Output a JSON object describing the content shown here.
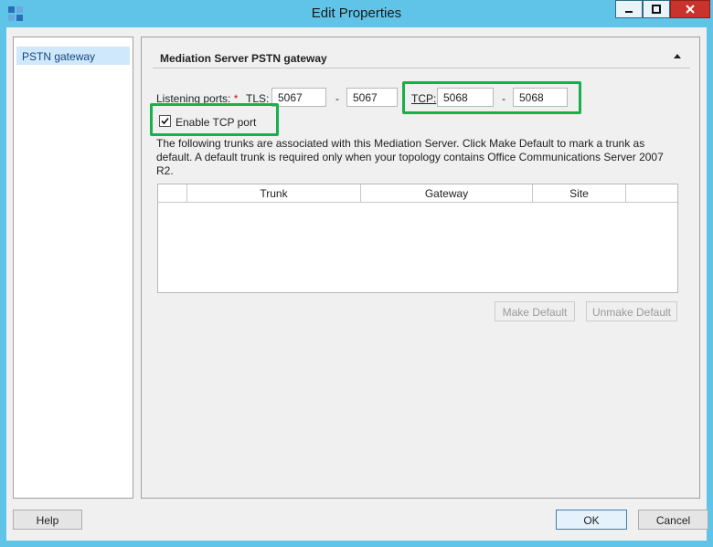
{
  "window": {
    "title": "Edit Properties"
  },
  "nav": {
    "items": [
      {
        "label": "PSTN gateway"
      }
    ]
  },
  "section": {
    "title": "Mediation Server PSTN gateway"
  },
  "ports": {
    "label": "Listening ports:",
    "required_mark": "*",
    "tls_label": "TLS:",
    "tls_from": "5067",
    "tls_to": "5067",
    "dash": "-",
    "tcp_label": "TCP:",
    "tcp_from": "5068",
    "tcp_to": "5068"
  },
  "enable_tcp": {
    "label": "Enable TCP port",
    "checked": true
  },
  "description": "The following trunks are associated with this Mediation Server. Click Make Default to mark a trunk as default. A default trunk is required only when your topology contains Office Communications Server 2007 R2.",
  "trunks_table": {
    "columns": [
      "",
      "Trunk",
      "Gateway",
      "Site",
      ""
    ],
    "rows": []
  },
  "buttons": {
    "make_default": "Make Default",
    "unmake_default": "Unmake Default",
    "help": "Help",
    "ok": "OK",
    "cancel": "Cancel"
  },
  "colors": {
    "highlight": "#18b04a",
    "titlebar": "#5fc4e8",
    "close": "#c9322d"
  }
}
